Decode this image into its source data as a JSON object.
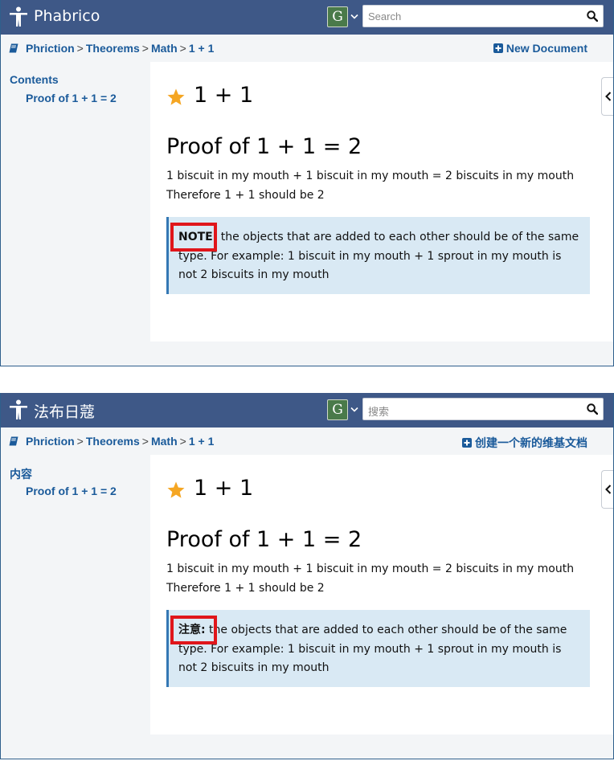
{
  "panels": [
    {
      "app_title": "Phabrico",
      "avatar_letter": "G",
      "search_placeholder": "Search",
      "breadcrumbs": [
        "Phriction",
        "Theorems",
        "Math",
        "1 + 1"
      ],
      "breadcrumb_separator": ">",
      "new_document_label": "New Document",
      "toc_title": "Contents",
      "toc_items": [
        "Proof of 1 + 1 = 2"
      ],
      "doc_title": "1 + 1",
      "heading": "Proof of 1 + 1 = 2",
      "paragraphs": [
        "1 biscuit in my mouth + 1 biscuit in my mouth = 2 biscuits in my mouth",
        "Therefore 1 + 1 should be 2"
      ],
      "note_label": "NOTE:",
      "note_text": " the objects that are added to each other should be of the same type. For example: 1 biscuit in my mouth + 1 sprout in my mouth is not 2 biscuits in my mouth"
    },
    {
      "app_title": "法布日蔻",
      "avatar_letter": "G",
      "search_placeholder": "搜索",
      "breadcrumbs": [
        "Phriction",
        "Theorems",
        "Math",
        "1 + 1"
      ],
      "breadcrumb_separator": ">",
      "new_document_label": "创建一个新的维基文档",
      "toc_title": "内容",
      "toc_items": [
        "Proof of 1 + 1 = 2"
      ],
      "doc_title": "1 + 1",
      "heading": "Proof of 1 + 1 = 2",
      "paragraphs": [
        "1 biscuit in my mouth + 1 biscuit in my mouth = 2 biscuits in my mouth",
        "Therefore 1 + 1 should be 2"
      ],
      "note_label": "注意:",
      "note_text": " the objects that are added to each other should be of the same type. For example: 1 biscuit in my mouth + 1 sprout in my mouth is not 2 biscuits in my mouth"
    }
  ],
  "colors": {
    "topbar": "#3e5887",
    "link": "#1a5a9a",
    "note_background": "#d9e9f4",
    "note_border": "#3478b4",
    "highlight": "#e0161b",
    "star": "#f5a623",
    "avatar": "#4a7a4a"
  },
  "icons": [
    "person-logo-icon",
    "chevron-down-icon",
    "search-icon",
    "book-icon",
    "plus-square-icon",
    "star-icon",
    "chevron-left-icon"
  ]
}
